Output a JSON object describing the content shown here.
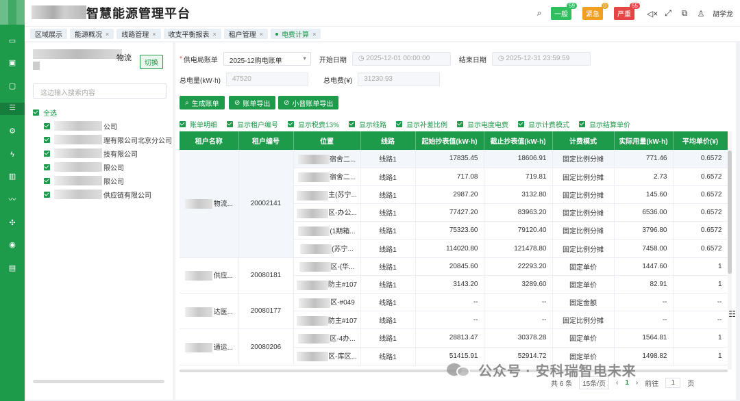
{
  "app": {
    "title": "智慧能源管理平台",
    "user": "胡学龙"
  },
  "alerts": [
    {
      "label": "一般",
      "count": "59",
      "color": "#2fbf5f"
    },
    {
      "label": "紧急",
      "count": "0",
      "color": "#f0a020"
    },
    {
      "label": "严重",
      "count": "55",
      "color": "#e64545"
    }
  ],
  "tabs": [
    {
      "label": "区域展示",
      "closable": false
    },
    {
      "label": "能源概况",
      "closable": true
    },
    {
      "label": "线路管理",
      "closable": true
    },
    {
      "label": "收支平衡报表",
      "closable": true
    },
    {
      "label": "租户管理",
      "closable": true
    },
    {
      "label": "电费计算",
      "closable": true,
      "active": true
    }
  ],
  "side": {
    "org_name": "物流",
    "switch_label": "切换",
    "search_placeholder": "这边输入搜索内容",
    "all_label": "全选",
    "items": [
      "公司",
      "理有限公司北京分公司",
      "技有限公司",
      "限公司",
      "限公司",
      "供应链有限公司"
    ]
  },
  "form": {
    "bill_label": "供电局账单",
    "bill_value": "2025-12购电账单",
    "start_label": "开始日期",
    "start_value": "2025-12-01 00:00:00",
    "end_label": "结束日期",
    "end_value": "2025-12-31 23:59:59",
    "total_kwh_label": "总电量(kW·h)",
    "total_kwh_value": "47520",
    "total_fee_label": "总电费(¥)",
    "total_fee_value": "31230.93"
  },
  "buttons": {
    "generate": "生成账单",
    "export": "账单导出",
    "small_export": "小普账单导出"
  },
  "options": [
    "账单明细",
    "显示租户编号",
    "显示税费13%",
    "显示线路",
    "显示补差比例",
    "显示电度电费",
    "显示计费模式",
    "显示结算单价"
  ],
  "table": {
    "headers": [
      "租户名称",
      "租户编号",
      "位置",
      "线路",
      "起始抄表值(kW·h)",
      "截止抄表值(kW·h)",
      "计费模式",
      "实际用量(kW·h)",
      "平均单价(¥)"
    ],
    "groups": [
      {
        "name": "物流...",
        "id": "20002141",
        "rows": [
          {
            "pos": "宿舍二...",
            "line": "线路1",
            "start": "17835.45",
            "end": "18606.91",
            "mode": "固定比例分摊",
            "usage": "771.46",
            "price": "0.6572"
          },
          {
            "pos": "宿舍二...",
            "line": "线路1",
            "start": "717.08",
            "end": "719.81",
            "mode": "固定比例分摊",
            "usage": "2.73",
            "price": "0.6572"
          },
          {
            "pos": "主(苏宁...",
            "line": "线路1",
            "start": "2987.20",
            "end": "3132.80",
            "mode": "固定比例分摊",
            "usage": "145.60",
            "price": "0.6572"
          },
          {
            "pos": "区-办公...",
            "line": "线路1",
            "start": "77427.20",
            "end": "83963.20",
            "mode": "固定比例分摊",
            "usage": "6536.00",
            "price": "0.6572"
          },
          {
            "pos": "(1期箱...",
            "line": "线路1",
            "start": "75323.60",
            "end": "79120.40",
            "mode": "固定比例分摊",
            "usage": "3796.80",
            "price": "0.6572"
          },
          {
            "pos": "(苏宁...",
            "line": "线路1",
            "start": "114020.80",
            "end": "121478.80",
            "mode": "固定比例分摊",
            "usage": "7458.00",
            "price": "0.6572"
          }
        ]
      },
      {
        "name": "供应...",
        "id": "20080181",
        "rows": [
          {
            "pos": "区-(华...",
            "line": "线路1",
            "start": "20845.60",
            "end": "22293.20",
            "mode": "固定单价",
            "usage": "1447.60",
            "price": "1"
          },
          {
            "pos": "防主#107",
            "line": "线路1",
            "start": "3143.20",
            "end": "3289.60",
            "mode": "固定单价",
            "usage": "82.91",
            "price": "1"
          }
        ]
      },
      {
        "name": "达医...",
        "id": "20080177",
        "rows": [
          {
            "pos": "区-#049",
            "line": "线路1",
            "start": "--",
            "end": "--",
            "mode": "固定金额",
            "usage": "--",
            "price": "--"
          },
          {
            "pos": "防主#107",
            "line": "线路1",
            "start": "--",
            "end": "--",
            "mode": "固定比例分摊",
            "usage": "--",
            "price": "--"
          }
        ]
      },
      {
        "name": "通运...",
        "id": "20080206",
        "rows": [
          {
            "pos": "区-4办...",
            "line": "线路1",
            "start": "28813.47",
            "end": "30378.28",
            "mode": "固定单价",
            "usage": "1564.81",
            "price": "1"
          },
          {
            "pos": "区-库区...",
            "line": "线路1",
            "start": "51415.91",
            "end": "52914.72",
            "mode": "固定单价",
            "usage": "1498.82",
            "price": "1"
          }
        ]
      }
    ]
  },
  "pager": {
    "total": "共 6 条",
    "page_size": "15条/页",
    "current": "1",
    "goto": "前往",
    "goto_value": "1",
    "page_suffix": "页"
  },
  "watermark": {
    "text": "公众号 · 安科瑞智电未来"
  },
  "colors": {
    "primary": "#1e9a4b"
  }
}
